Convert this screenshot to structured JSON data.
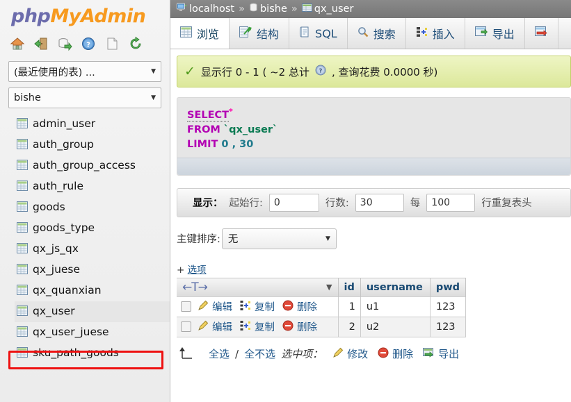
{
  "brand": {
    "php": "php",
    "my": "My",
    "admin": "Admin"
  },
  "sidebar": {
    "quick_icons": [
      {
        "name": "home-icon",
        "title": "主页"
      },
      {
        "name": "logout-icon",
        "title": "退出"
      },
      {
        "name": "database-export-icon",
        "title": "导出"
      },
      {
        "name": "help-icon",
        "title": "帮助"
      },
      {
        "name": "documentation-icon",
        "title": "文档"
      },
      {
        "name": "reload-icon",
        "title": "重新加载"
      }
    ],
    "recent_tables_select": "(最近使用的表) ...",
    "database_select": "bishe",
    "tables": [
      "admin_user",
      "auth_group",
      "auth_group_access",
      "auth_rule",
      "goods",
      "goods_type",
      "qx_js_qx",
      "qx_juese",
      "qx_quanxian",
      "qx_user",
      "qx_user_juese",
      "sku_path_goods"
    ],
    "selected_table": "qx_user",
    "highlight_color": "#ee1111"
  },
  "breadcrumb": {
    "server": "localhost",
    "database": "bishe",
    "table": "qx_user",
    "separator": "»"
  },
  "tabs": [
    {
      "label": "浏览",
      "icon": "browse-icon",
      "active": true
    },
    {
      "label": "结构",
      "icon": "structure-icon",
      "active": false
    },
    {
      "label": "SQL",
      "icon": "sql-icon",
      "active": false
    },
    {
      "label": "搜索",
      "icon": "search-icon",
      "active": false
    },
    {
      "label": "插入",
      "icon": "insert-icon",
      "active": false
    },
    {
      "label": "导出",
      "icon": "export-icon",
      "active": false
    },
    {
      "label": "",
      "icon": "import-icon",
      "active": false
    }
  ],
  "alert": {
    "icon": "success-check-icon",
    "text": "显示行 0 - 1 ( ~2 总计",
    "help_icon": "help-bubble-icon",
    "text2": ", 查询花费 0.0000 秒)"
  },
  "sql": {
    "keyword_select": "SELECT",
    "star": "*",
    "keyword_from": "FROM",
    "table_ident": "`qx_user`",
    "keyword_limit": "LIMIT",
    "limit_offset": "0",
    "comma": ",",
    "limit_count": "30"
  },
  "display_bar": {
    "title": "显示：",
    "start_label": "起始行:",
    "start_value": "0",
    "rows_label": "行数:",
    "rows_value": "30",
    "every_label": "每",
    "every_value": "100",
    "repeat_label": "行重复表头"
  },
  "sort": {
    "label": "主键排序:",
    "value": "无"
  },
  "options": {
    "plus": "+",
    "label": "选项"
  },
  "table": {
    "sort_arrows": "←T→",
    "headers": [
      "id",
      "username",
      "pwd"
    ],
    "row_actions": {
      "edit": "编辑",
      "copy": "复制",
      "delete": "删除"
    },
    "rows": [
      {
        "id": "1",
        "username": "u1",
        "pwd": "123"
      },
      {
        "id": "2",
        "username": "u2",
        "pwd": "123"
      }
    ]
  },
  "footer": {
    "select_all": "全选",
    "slash": "/",
    "select_none": "全不选",
    "with_selected": "选中项：",
    "modify": "修改",
    "delete": "删除",
    "export": "导出"
  }
}
